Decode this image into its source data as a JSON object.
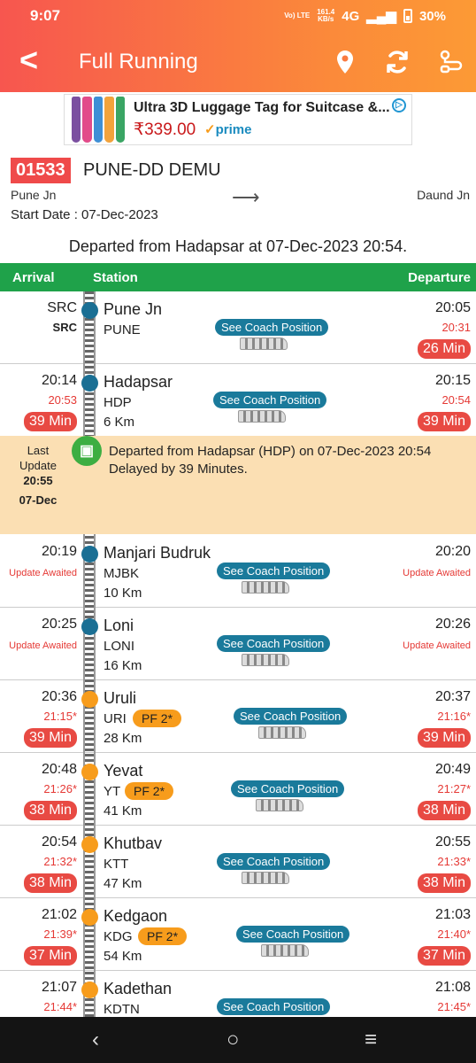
{
  "status_bar": {
    "time": "9:07",
    "network": "4G",
    "volte": "Vo) LTE",
    "speed_value": "161.4",
    "speed_unit": "KB/s",
    "battery": "30%"
  },
  "app_bar": {
    "title": "Full Running",
    "back_icon": "back-arrow-icon",
    "actions": [
      "location-pin-icon",
      "refresh-icon",
      "route-icon"
    ]
  },
  "ad": {
    "headline": "Ultra 3D Luggage Tag for Suitcase &...",
    "price": "₹339.00",
    "prime_check": "✓",
    "prime_label": "prime",
    "thumb_colors": [
      "#7b4fa0",
      "#e24b8a",
      "#3e8fd6",
      "#f2a33c",
      "#3aa564"
    ]
  },
  "train": {
    "number": "01533",
    "name": "PUNE-DD DEMU",
    "source": "Pune Jn",
    "destination": "Daund Jn",
    "start_date": "Start Date : 07-Dec-2023"
  },
  "departed_text": "Departed from Hadapsar at 07-Dec-2023 20:54.",
  "header": {
    "arrival": "Arrival",
    "station": "Station",
    "departure": "Departure"
  },
  "coach_label": "See Coach Position",
  "live_update": {
    "label1": "Last",
    "label2": "Update",
    "time": "20:55",
    "date": "07-Dec",
    "message": "Departed from Hadapsar (HDP) on 07-Dec-2023 20:54 Delayed by 39 Minutes."
  },
  "stations": [
    {
      "name": "Pune Jn",
      "code": "PUNE",
      "km": "",
      "arr": "SRC",
      "arr_actual": "SRC",
      "arr_delay": "",
      "dep": "20:05",
      "dep_actual": "20:31",
      "dep_delay": "26 Min",
      "pf": "",
      "await": false
    },
    {
      "name": "Hadapsar",
      "code": "HDP",
      "km": "6 Km",
      "arr": "20:14",
      "arr_actual": "20:53",
      "arr_delay": "39 Min",
      "dep": "20:15",
      "dep_actual": "20:54",
      "dep_delay": "39 Min",
      "pf": "",
      "await": false
    },
    {
      "name": "Manjari Budruk",
      "code": "MJBK",
      "km": "10 Km",
      "arr": "20:19",
      "arr_actual": "",
      "arr_delay": "",
      "dep": "20:20",
      "dep_actual": "",
      "dep_delay": "",
      "pf": "",
      "await": true
    },
    {
      "name": "Loni",
      "code": "LONI",
      "km": "16 Km",
      "arr": "20:25",
      "arr_actual": "",
      "arr_delay": "",
      "dep": "20:26",
      "dep_actual": "",
      "dep_delay": "",
      "pf": "",
      "await": true
    },
    {
      "name": "Uruli",
      "code": "URI",
      "km": "28 Km",
      "arr": "20:36",
      "arr_actual": "21:15*",
      "arr_delay": "39 Min",
      "dep": "20:37",
      "dep_actual": "21:16*",
      "dep_delay": "39 Min",
      "pf": "PF 2*",
      "await": false
    },
    {
      "name": "Yevat",
      "code": "YT",
      "km": "41 Km",
      "arr": "20:48",
      "arr_actual": "21:26*",
      "arr_delay": "38 Min",
      "dep": "20:49",
      "dep_actual": "21:27*",
      "dep_delay": "38 Min",
      "pf": "PF 2*",
      "await": false
    },
    {
      "name": "Khutbav",
      "code": "KTT",
      "km": "47 Km",
      "arr": "20:54",
      "arr_actual": "21:32*",
      "arr_delay": "38 Min",
      "dep": "20:55",
      "dep_actual": "21:33*",
      "dep_delay": "38 Min",
      "pf": "",
      "await": false
    },
    {
      "name": "Kedgaon",
      "code": "KDG",
      "km": "54 Km",
      "arr": "21:02",
      "arr_actual": "21:39*",
      "arr_delay": "37 Min",
      "dep": "21:03",
      "dep_actual": "21:40*",
      "dep_delay": "37 Min",
      "pf": "PF 2*",
      "await": false
    },
    {
      "name": "Kadethan",
      "code": "KDTN",
      "km": "",
      "arr": "21:07",
      "arr_actual": "21:44*",
      "arr_delay": "",
      "dep": "21:08",
      "dep_actual": "21:45*",
      "dep_delay": "",
      "pf": "",
      "await": false
    }
  ],
  "update_awaited": "Update Awaited",
  "nav": {
    "back": "‹",
    "home": "○",
    "menu": "≡"
  }
}
